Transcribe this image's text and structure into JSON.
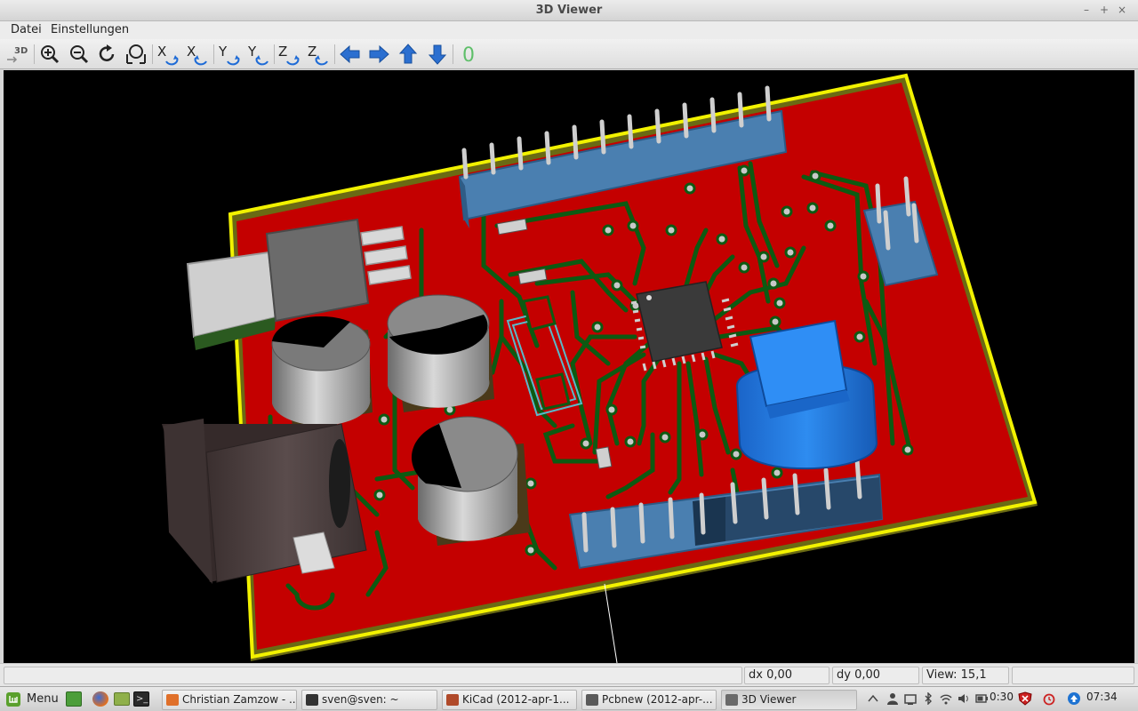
{
  "window": {
    "title": "3D Viewer"
  },
  "window_controls": {
    "minimize": "–",
    "maximize": "+",
    "close": "×"
  },
  "menubar": [
    {
      "label": "Datei"
    },
    {
      "label": "Einstellungen"
    }
  ],
  "toolbar": {
    "reload_3d_label": "3D",
    "buttons": [
      {
        "name": "reload-3d",
        "icon": "reload-3d-icon"
      },
      {
        "name": "zoom-in",
        "icon": "zoom-in-icon"
      },
      {
        "name": "zoom-out",
        "icon": "zoom-out-icon"
      },
      {
        "name": "redraw",
        "icon": "redraw-icon"
      },
      {
        "name": "zoom-fit",
        "icon": "zoom-fit-icon"
      },
      {
        "name": "rotate-x-cw",
        "icon": "rotate-x-cw-icon"
      },
      {
        "name": "rotate-x-ccw",
        "icon": "rotate-x-ccw-icon"
      },
      {
        "name": "rotate-y-cw",
        "icon": "rotate-y-cw-icon"
      },
      {
        "name": "rotate-y-ccw",
        "icon": "rotate-y-ccw-icon"
      },
      {
        "name": "rotate-z-cw",
        "icon": "rotate-z-cw-icon"
      },
      {
        "name": "rotate-z-ccw",
        "icon": "rotate-z-ccw-icon"
      },
      {
        "name": "pan-left",
        "icon": "arrow-left-icon"
      },
      {
        "name": "pan-right",
        "icon": "arrow-right-icon"
      },
      {
        "name": "pan-up",
        "icon": "arrow-up-icon"
      },
      {
        "name": "pan-down",
        "icon": "arrow-down-icon"
      },
      {
        "name": "ortho",
        "icon": "ortho-icon"
      }
    ],
    "rot_letters": {
      "x": "X",
      "y": "Y",
      "z": "Z"
    },
    "ortho_glyph": "0"
  },
  "status": {
    "dx": "dx 0,00",
    "dy": "dy 0,00",
    "view": "View: 15,1"
  },
  "taskbar": {
    "menu_label": "Menu",
    "tasks": [
      {
        "label": "Christian Zamzow - ...",
        "icon": "firefox-icon",
        "color": "#e0702a",
        "active": false
      },
      {
        "label": "sven@sven: ~",
        "icon": "terminal-icon",
        "color": "#333333",
        "active": false
      },
      {
        "label": "KiCad (2012-apr-1...",
        "icon": "kicad-icon",
        "color": "#b04a2a",
        "active": false
      },
      {
        "label": "Pcbnew (2012-apr-...",
        "icon": "pcbnew-icon",
        "color": "#5a5a5a",
        "active": false
      },
      {
        "label": "3D Viewer",
        "icon": "3d-viewer-icon",
        "color": "#6a6a6a",
        "active": true
      }
    ],
    "battery_time": "0:30",
    "clock": "07:34"
  },
  "colors": {
    "board": "#c40000",
    "board_edge": "#ffff00",
    "trace": "#0d5a12",
    "header": "#4a7fb0",
    "button_cap": "#1e78e0"
  }
}
